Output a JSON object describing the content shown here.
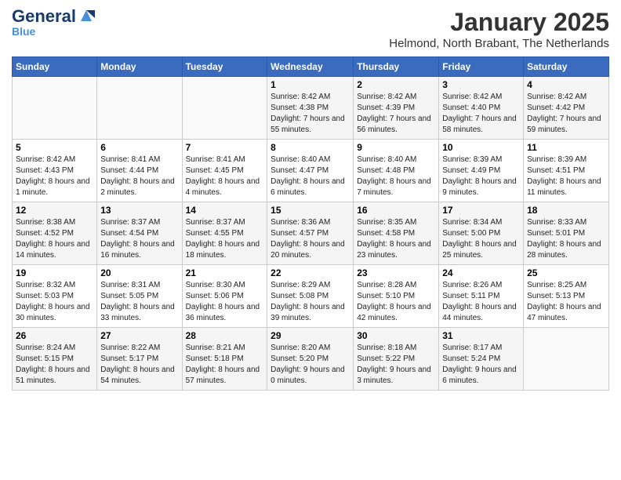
{
  "logo": {
    "general": "General",
    "blue": "Blue"
  },
  "title": "January 2025",
  "location": "Helmond, North Brabant, The Netherlands",
  "days_of_week": [
    "Sunday",
    "Monday",
    "Tuesday",
    "Wednesday",
    "Thursday",
    "Friday",
    "Saturday"
  ],
  "weeks": [
    [
      {
        "day": "",
        "sunrise": "",
        "sunset": "",
        "daylight": ""
      },
      {
        "day": "",
        "sunrise": "",
        "sunset": "",
        "daylight": ""
      },
      {
        "day": "",
        "sunrise": "",
        "sunset": "",
        "daylight": ""
      },
      {
        "day": "1",
        "sunrise": "Sunrise: 8:42 AM",
        "sunset": "Sunset: 4:38 PM",
        "daylight": "Daylight: 7 hours and 55 minutes."
      },
      {
        "day": "2",
        "sunrise": "Sunrise: 8:42 AM",
        "sunset": "Sunset: 4:39 PM",
        "daylight": "Daylight: 7 hours and 56 minutes."
      },
      {
        "day": "3",
        "sunrise": "Sunrise: 8:42 AM",
        "sunset": "Sunset: 4:40 PM",
        "daylight": "Daylight: 7 hours and 58 minutes."
      },
      {
        "day": "4",
        "sunrise": "Sunrise: 8:42 AM",
        "sunset": "Sunset: 4:42 PM",
        "daylight": "Daylight: 7 hours and 59 minutes."
      }
    ],
    [
      {
        "day": "5",
        "sunrise": "Sunrise: 8:42 AM",
        "sunset": "Sunset: 4:43 PM",
        "daylight": "Daylight: 8 hours and 1 minute."
      },
      {
        "day": "6",
        "sunrise": "Sunrise: 8:41 AM",
        "sunset": "Sunset: 4:44 PM",
        "daylight": "Daylight: 8 hours and 2 minutes."
      },
      {
        "day": "7",
        "sunrise": "Sunrise: 8:41 AM",
        "sunset": "Sunset: 4:45 PM",
        "daylight": "Daylight: 8 hours and 4 minutes."
      },
      {
        "day": "8",
        "sunrise": "Sunrise: 8:40 AM",
        "sunset": "Sunset: 4:47 PM",
        "daylight": "Daylight: 8 hours and 6 minutes."
      },
      {
        "day": "9",
        "sunrise": "Sunrise: 8:40 AM",
        "sunset": "Sunset: 4:48 PM",
        "daylight": "Daylight: 8 hours and 7 minutes."
      },
      {
        "day": "10",
        "sunrise": "Sunrise: 8:39 AM",
        "sunset": "Sunset: 4:49 PM",
        "daylight": "Daylight: 8 hours and 9 minutes."
      },
      {
        "day": "11",
        "sunrise": "Sunrise: 8:39 AM",
        "sunset": "Sunset: 4:51 PM",
        "daylight": "Daylight: 8 hours and 11 minutes."
      }
    ],
    [
      {
        "day": "12",
        "sunrise": "Sunrise: 8:38 AM",
        "sunset": "Sunset: 4:52 PM",
        "daylight": "Daylight: 8 hours and 14 minutes."
      },
      {
        "day": "13",
        "sunrise": "Sunrise: 8:37 AM",
        "sunset": "Sunset: 4:54 PM",
        "daylight": "Daylight: 8 hours and 16 minutes."
      },
      {
        "day": "14",
        "sunrise": "Sunrise: 8:37 AM",
        "sunset": "Sunset: 4:55 PM",
        "daylight": "Daylight: 8 hours and 18 minutes."
      },
      {
        "day": "15",
        "sunrise": "Sunrise: 8:36 AM",
        "sunset": "Sunset: 4:57 PM",
        "daylight": "Daylight: 8 hours and 20 minutes."
      },
      {
        "day": "16",
        "sunrise": "Sunrise: 8:35 AM",
        "sunset": "Sunset: 4:58 PM",
        "daylight": "Daylight: 8 hours and 23 minutes."
      },
      {
        "day": "17",
        "sunrise": "Sunrise: 8:34 AM",
        "sunset": "Sunset: 5:00 PM",
        "daylight": "Daylight: 8 hours and 25 minutes."
      },
      {
        "day": "18",
        "sunrise": "Sunrise: 8:33 AM",
        "sunset": "Sunset: 5:01 PM",
        "daylight": "Daylight: 8 hours and 28 minutes."
      }
    ],
    [
      {
        "day": "19",
        "sunrise": "Sunrise: 8:32 AM",
        "sunset": "Sunset: 5:03 PM",
        "daylight": "Daylight: 8 hours and 30 minutes."
      },
      {
        "day": "20",
        "sunrise": "Sunrise: 8:31 AM",
        "sunset": "Sunset: 5:05 PM",
        "daylight": "Daylight: 8 hours and 33 minutes."
      },
      {
        "day": "21",
        "sunrise": "Sunrise: 8:30 AM",
        "sunset": "Sunset: 5:06 PM",
        "daylight": "Daylight: 8 hours and 36 minutes."
      },
      {
        "day": "22",
        "sunrise": "Sunrise: 8:29 AM",
        "sunset": "Sunset: 5:08 PM",
        "daylight": "Daylight: 8 hours and 39 minutes."
      },
      {
        "day": "23",
        "sunrise": "Sunrise: 8:28 AM",
        "sunset": "Sunset: 5:10 PM",
        "daylight": "Daylight: 8 hours and 42 minutes."
      },
      {
        "day": "24",
        "sunrise": "Sunrise: 8:26 AM",
        "sunset": "Sunset: 5:11 PM",
        "daylight": "Daylight: 8 hours and 44 minutes."
      },
      {
        "day": "25",
        "sunrise": "Sunrise: 8:25 AM",
        "sunset": "Sunset: 5:13 PM",
        "daylight": "Daylight: 8 hours and 47 minutes."
      }
    ],
    [
      {
        "day": "26",
        "sunrise": "Sunrise: 8:24 AM",
        "sunset": "Sunset: 5:15 PM",
        "daylight": "Daylight: 8 hours and 51 minutes."
      },
      {
        "day": "27",
        "sunrise": "Sunrise: 8:22 AM",
        "sunset": "Sunset: 5:17 PM",
        "daylight": "Daylight: 8 hours and 54 minutes."
      },
      {
        "day": "28",
        "sunrise": "Sunrise: 8:21 AM",
        "sunset": "Sunset: 5:18 PM",
        "daylight": "Daylight: 8 hours and 57 minutes."
      },
      {
        "day": "29",
        "sunrise": "Sunrise: 8:20 AM",
        "sunset": "Sunset: 5:20 PM",
        "daylight": "Daylight: 9 hours and 0 minutes."
      },
      {
        "day": "30",
        "sunrise": "Sunrise: 8:18 AM",
        "sunset": "Sunset: 5:22 PM",
        "daylight": "Daylight: 9 hours and 3 minutes."
      },
      {
        "day": "31",
        "sunrise": "Sunrise: 8:17 AM",
        "sunset": "Sunset: 5:24 PM",
        "daylight": "Daylight: 9 hours and 6 minutes."
      },
      {
        "day": "",
        "sunrise": "",
        "sunset": "",
        "daylight": ""
      }
    ]
  ]
}
